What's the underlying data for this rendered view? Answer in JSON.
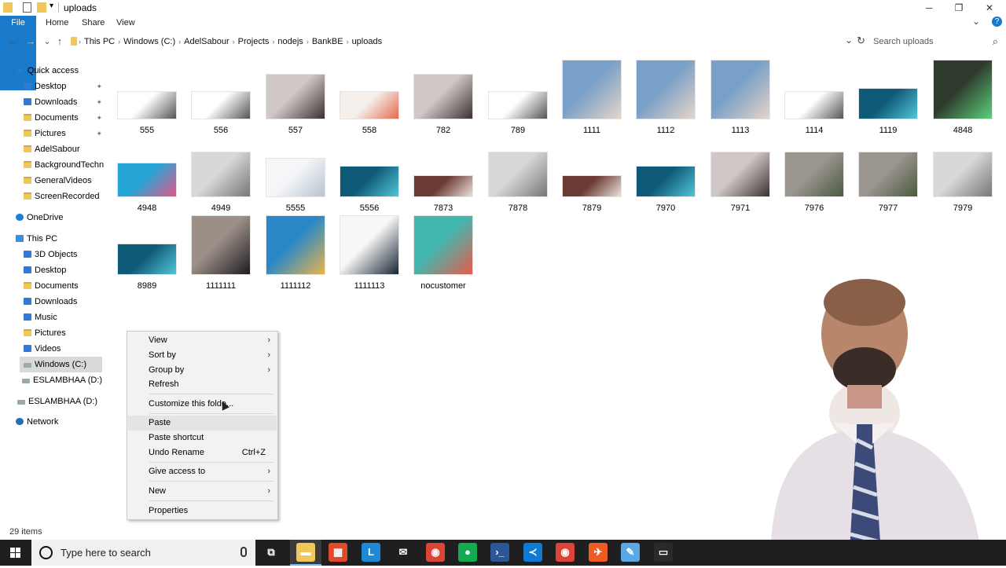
{
  "window": {
    "title": "uploads",
    "minimize_glyph": "─",
    "restore_glyph": "❐",
    "close_glyph": "✕"
  },
  "ribbon": {
    "tabs": [
      "File",
      "Home",
      "Share",
      "View"
    ],
    "expand_glyph": "⌄",
    "help_glyph": "?"
  },
  "address": {
    "back": "←",
    "forward": "→",
    "recent": "⌄",
    "up": "↑",
    "breadcrumbs": [
      "This PC",
      "Windows (C:)",
      "AdelSabour",
      "Projects",
      "nodejs",
      "BankBE",
      "uploads"
    ],
    "separator": "›",
    "dropdown": "⌄",
    "refresh": "↻",
    "search_placeholder": "Search uploads",
    "search_icon": "⌕"
  },
  "sidebar": {
    "quick_access": "Quick access",
    "quick_items": [
      "Desktop",
      "Downloads",
      "Documents",
      "Pictures",
      "AdelSabour",
      "BackgroundTechnica",
      "GeneralVideos",
      "ScreenRecorded"
    ],
    "pin_glyph": "📌",
    "onedrive": "OneDrive",
    "this_pc": "This PC",
    "pc_items": [
      "3D Objects",
      "Desktop",
      "Documents",
      "Downloads",
      "Music",
      "Pictures",
      "Videos",
      "Windows (C:)",
      "ESLAMBHAA (D:)"
    ],
    "drive_d": "ESLAMBHAA (D:)",
    "network": "Network"
  },
  "files": [
    {
      "name": "555",
      "thumb": "robot"
    },
    {
      "name": "556",
      "thumb": "robot"
    },
    {
      "name": "557",
      "thumb": "group"
    },
    {
      "name": "558",
      "thumb": "desk"
    },
    {
      "name": "782",
      "thumb": "group"
    },
    {
      "name": "789",
      "thumb": "robot"
    },
    {
      "name": "1111",
      "thumb": "man-blue"
    },
    {
      "name": "1112",
      "thumb": "man-blue"
    },
    {
      "name": "1113",
      "thumb": "man-blue"
    },
    {
      "name": "1114",
      "thumb": "robot"
    },
    {
      "name": "1119",
      "thumb": "ai-head"
    },
    {
      "name": "4848",
      "thumb": "green-poster"
    },
    {
      "name": "4948",
      "thumb": "brain"
    },
    {
      "name": "4949",
      "thumb": "keyboard"
    },
    {
      "name": "5555",
      "thumb": "sketch"
    },
    {
      "name": "5556",
      "thumb": "ai-head"
    },
    {
      "name": "7873",
      "thumb": "meeting"
    },
    {
      "name": "7878",
      "thumb": "keyboard"
    },
    {
      "name": "7879",
      "thumb": "meeting"
    },
    {
      "name": "7970",
      "thumb": "ai-head"
    },
    {
      "name": "7971",
      "thumb": "group"
    },
    {
      "name": "7976",
      "thumb": "students"
    },
    {
      "name": "7977",
      "thumb": "students"
    },
    {
      "name": "7979",
      "thumb": "keyboard"
    },
    {
      "name": "8989",
      "thumb": "ai-head"
    },
    {
      "name": "1111111",
      "thumb": "portrait-suit"
    },
    {
      "name": "1111112",
      "thumb": "portrait-colorful"
    },
    {
      "name": "1111113",
      "thumb": "portrait-plain"
    },
    {
      "name": "nocustomer",
      "thumb": "cartoon"
    }
  ],
  "status": {
    "item_count": "29 items"
  },
  "context_menu": {
    "items": [
      {
        "label": "View",
        "submenu": true
      },
      {
        "label": "Sort by",
        "submenu": true
      },
      {
        "label": "Group by",
        "submenu": true
      },
      {
        "label": "Refresh"
      },
      {
        "label": "Customize this folde..."
      },
      {
        "label": "Paste",
        "highlighted": true
      },
      {
        "label": "Paste shortcut"
      },
      {
        "label": "Undo Rename",
        "shortcut": "Ctrl+Z"
      },
      {
        "label": "Give access to",
        "submenu": true
      },
      {
        "label": "New",
        "submenu": true
      },
      {
        "label": "Properties"
      }
    ],
    "submenu_arrow": "›"
  },
  "taskbar": {
    "search_placeholder": "Type here to search",
    "apps": [
      {
        "name": "task-view",
        "glyph": "⧉",
        "color": "#1f1f1f"
      },
      {
        "name": "file-explorer",
        "glyph": "▬",
        "color": "#f0c85a"
      },
      {
        "name": "store",
        "glyph": "▦",
        "color": "#e04a2a"
      },
      {
        "name": "lapp",
        "glyph": "L",
        "color": "#1c8ad6"
      },
      {
        "name": "mail",
        "glyph": "✉",
        "color": "#1f1f1f"
      },
      {
        "name": "chrome",
        "glyph": "◉",
        "color": "#db4437"
      },
      {
        "name": "mongodb",
        "glyph": "●",
        "color": "#13aa52"
      },
      {
        "name": "powershell",
        "glyph": "›_",
        "color": "#2b5797"
      },
      {
        "name": "vscode",
        "glyph": "≺",
        "color": "#0e7ad3"
      },
      {
        "name": "chrome-2",
        "glyph": "◉",
        "color": "#db4437"
      },
      {
        "name": "postman",
        "glyph": "✈",
        "color": "#ef5b25"
      },
      {
        "name": "notepad",
        "glyph": "✎",
        "color": "#5aa9e6"
      },
      {
        "name": "cmd",
        "glyph": "▭",
        "color": "#2a2a2a"
      }
    ]
  },
  "colors": {
    "accent": "#1979ca",
    "taskbar": "#1f1f1f",
    "menu_bg": "#f2f2f2",
    "selected": "#d9d9d9"
  }
}
